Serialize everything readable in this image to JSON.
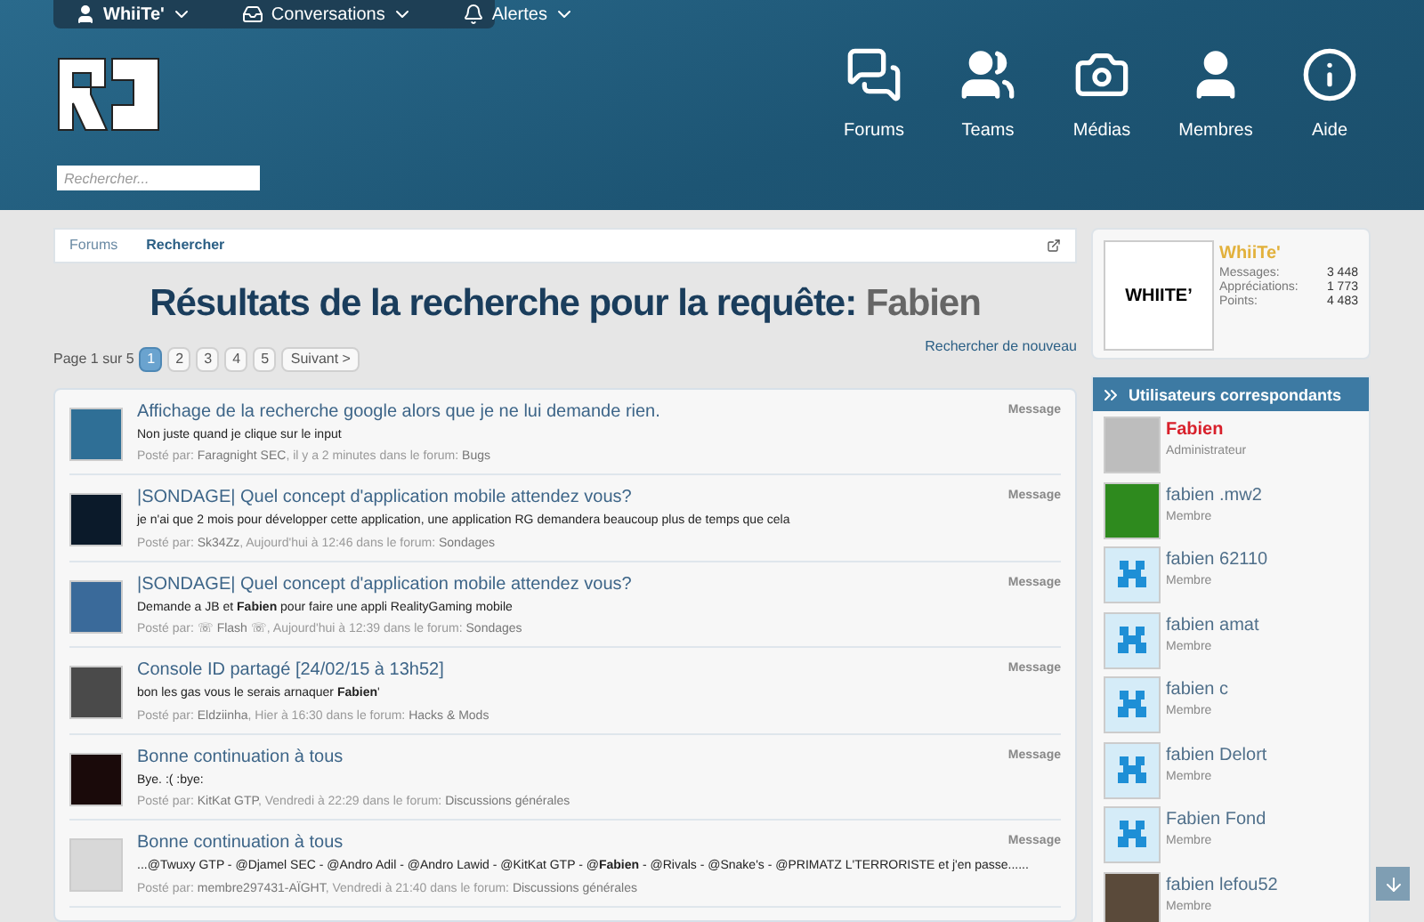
{
  "top_bar": {
    "user": "WhiiTe'",
    "items": [
      {
        "label": "Conversations",
        "kind": "inbox"
      },
      {
        "label": "Alertes",
        "kind": "bell"
      }
    ]
  },
  "search": {
    "placeholder": "Rechercher..."
  },
  "nav": [
    {
      "label": "Forums",
      "kind": "forums"
    },
    {
      "label": "Teams",
      "kind": "teams"
    },
    {
      "label": "Médias",
      "kind": "media"
    },
    {
      "label": "Membres",
      "kind": "members"
    },
    {
      "label": "Aide",
      "kind": "help"
    }
  ],
  "breadcrumb": [
    {
      "label": "Forums",
      "selected": false
    },
    {
      "label": "Rechercher",
      "selected": true
    }
  ],
  "title": {
    "text": "Résultats de la recherche pour la requête:",
    "query": "Fabien"
  },
  "pagination": {
    "label": "Page 1 sur 5",
    "pages": [
      {
        "label": "1",
        "selected": true
      },
      {
        "label": "2",
        "selected": false
      },
      {
        "label": "3",
        "selected": false
      },
      {
        "label": "4",
        "selected": false
      },
      {
        "label": "5",
        "selected": false
      }
    ],
    "next": "Suivant >",
    "search_again": "Rechercher de nouveau"
  },
  "results": [
    {
      "title": "Affichage de la recherche google alors que je ne lui demande rien.",
      "snippet": "Non juste quand je clique sur le input",
      "posted": "Posté par:",
      "author": "Faragnight SEC",
      "when": ", il y a 2 minutes dans le forum:",
      "forum": "Bugs",
      "type": "Message",
      "color": "#2f6f96"
    },
    {
      "title": "|SONDAGE| Quel concept d'application mobile attendez vous?",
      "snippet": "je n'ai que 2 mois pour développer cette application, une application RG demandera beaucoup plus de temps que cela",
      "posted": "Posté par:",
      "author": "Sk34Zz",
      "when": ", Aujourd'hui à 12:46 dans le forum:",
      "forum": "Sondages",
      "type": "Message",
      "color": "#0b1a2a"
    },
    {
      "title": "|SONDAGE| Quel concept d'application mobile attendez vous?",
      "snippet": "Demande a JB et **Fabien** pour faire une appli RealityGaming mobile",
      "posted": "Posté par:",
      "author": "☏ Flash ☏",
      "when": ", Aujourd'hui à 12:39 dans le forum:",
      "forum": "Sondages",
      "type": "Message",
      "color": "#3a6a9a"
    },
    {
      "title": "Console ID partagé [24/02/15 à 13h52]",
      "snippet": "bon les gas vous le serais arnaquer **Fabien**'",
      "posted": "Posté par:",
      "author": "Eldziinha",
      "when": ", Hier à 16:30 dans le forum:",
      "forum": "Hacks & Mods",
      "type": "Message",
      "color": "#4a4a4a"
    },
    {
      "title": "Bonne continuation à tous",
      "snippet": "Bye. :( :bye:",
      "posted": "Posté par:",
      "author": "KitKat GTP",
      "when": ", Vendredi à 22:29 dans le forum:",
      "forum": "Discussions générales",
      "type": "Message",
      "color": "#1a0a0a"
    },
    {
      "title": "Bonne continuation à tous",
      "snippet": "...@Twuxy GTP - @Djamel SEC - @Andro Adil - @Andro Lawid - @KitKat GTP - @**Fabien** - @Rivals - @Snake's - @PRIMATZ L'TERRORISTE et j'en passe......",
      "posted": "Posté par:",
      "author": "membre297431-AÏGHT",
      "when": ", Vendredi à 21:40 dans le forum:",
      "forum": "Discussions générales",
      "type": "Message",
      "color": "#d8d8d8"
    }
  ],
  "visitor": {
    "avatar_text": "WHIITE’",
    "name": "WhiiTe'",
    "stats": [
      {
        "label": "Messages:",
        "value": "3 448"
      },
      {
        "label": "Appréciations:",
        "value": "1 773"
      },
      {
        "label": "Points:",
        "value": "4 483"
      }
    ]
  },
  "members_panel": {
    "title": "Utilisateurs correspondants",
    "members": [
      {
        "name": "Fabien",
        "role": "Administrateur",
        "staff": true,
        "kind": "photo",
        "color": "#bdbdbd"
      },
      {
        "name": "fabien .mw2",
        "role": "Membre",
        "staff": false,
        "kind": "photo",
        "color": "#2e8a1e"
      },
      {
        "name": "fabien 62110",
        "role": "Membre",
        "staff": false,
        "kind": "default",
        "color": "#d5ecf8"
      },
      {
        "name": "fabien amat",
        "role": "Membre",
        "staff": false,
        "kind": "default",
        "color": "#d5ecf8"
      },
      {
        "name": "fabien c",
        "role": "Membre",
        "staff": false,
        "kind": "default",
        "color": "#d5ecf8"
      },
      {
        "name": "fabien Delort",
        "role": "Membre",
        "staff": false,
        "kind": "default",
        "color": "#d5ecf8"
      },
      {
        "name": "Fabien Fond",
        "role": "Membre",
        "staff": false,
        "kind": "default",
        "color": "#d5ecf8"
      },
      {
        "name": "fabien lefou52",
        "role": "Membre",
        "staff": false,
        "kind": "photo",
        "color": "#5a4a3a"
      }
    ]
  }
}
